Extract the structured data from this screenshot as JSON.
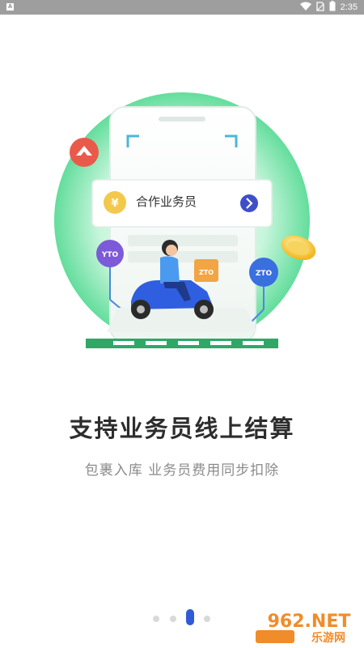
{
  "status_bar": {
    "left_icon": "A",
    "time": "2:35",
    "icons": [
      "wifi-icon",
      "sim-icon",
      "battery-icon"
    ]
  },
  "illustration": {
    "card_label": "合作业务员",
    "badge_left": "YTO",
    "badge_right": "ZTO",
    "box_label": "ZTO"
  },
  "headline": "支持业务员线上结算",
  "subline": "包裹入库 业务员费用同步扣除",
  "pager": {
    "count": 4,
    "active_index": 2
  },
  "watermark": {
    "big": "962.NET",
    "small": "乐游网"
  },
  "colors": {
    "green": "#3fd38c",
    "blue": "#3657d9",
    "red": "#ea5a4b",
    "gold": "#f5c542"
  }
}
